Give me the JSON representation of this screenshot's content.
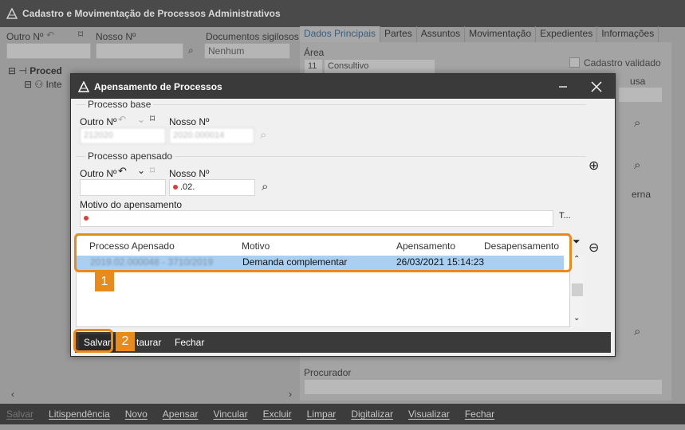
{
  "main": {
    "title": "Cadastro e Movimentação de Processos Administrativos",
    "outro_label": "Outro Nº",
    "nosso_label": "Nosso Nº",
    "sigilo_label": "Documentos sigilosos",
    "sigilo_value": "Nenhum",
    "tabs": [
      {
        "label": "Dados Principais"
      },
      {
        "label": "Partes"
      },
      {
        "label": "Assuntos"
      },
      {
        "label": "Movimentação"
      },
      {
        "label": "Expedientes"
      },
      {
        "label": "Informações"
      }
    ],
    "area_label": "Área",
    "area_code": "11",
    "area_value": "Consultivo",
    "cadastro_validado": "Cadastro validado",
    "procurador_label": "Procurador",
    "tree_item1": "Proced",
    "tree_item2": "Inte",
    "partial_usa": "usa",
    "partial_erna": "erna"
  },
  "toolbar": {
    "items": [
      {
        "label": "Salvar",
        "disabled": true
      },
      {
        "label": "Litispendência"
      },
      {
        "label": "Novo"
      },
      {
        "label": "Apensar"
      },
      {
        "label": "Vincular"
      },
      {
        "label": "Excluir"
      },
      {
        "label": "Limpar"
      },
      {
        "label": "Digitalizar"
      },
      {
        "label": "Visualizar"
      },
      {
        "label": "Fechar"
      }
    ]
  },
  "dialog": {
    "title": "Apensamento de Processos",
    "processo_base_label": "Processo base",
    "processo_apensado_label": "Processo apensado",
    "outro_label": "Outro Nº",
    "nosso_label": "Nosso Nº",
    "base_outro_value": "212020",
    "base_nosso_value": "2020.000014",
    "ap_nosso_value": ".02.",
    "motivo_label": "Motivo do apensamento",
    "motivo_value": "",
    "grid": {
      "columns": [
        "Processo Apensado",
        "Motivo",
        "Apensamento",
        "Desapensamento"
      ],
      "rows": [
        {
          "processo": "2019.02.000048 - 3710/2019",
          "motivo": "Demanda complementar",
          "apensamento": "26/03/2021 15:14:23",
          "desapensamento": ""
        }
      ]
    },
    "badges": {
      "one": "1",
      "two": "2"
    },
    "footer": {
      "save": "Salvar",
      "restore": "taurar",
      "close": "Fechar"
    }
  },
  "colors": {
    "highlight": "#e98a1c",
    "selection": "#a9d0f2",
    "required": "#e23b3b"
  }
}
